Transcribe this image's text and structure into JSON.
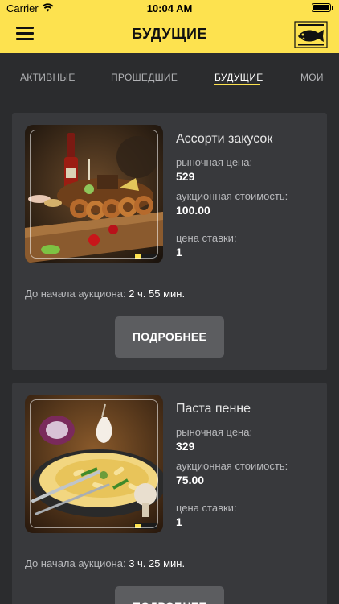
{
  "status_bar": {
    "carrier": "Carrier",
    "time": "10:04 AM"
  },
  "header": {
    "title": "БУДУЩИЕ",
    "accent_color": "#fde24f"
  },
  "tabs": [
    {
      "label": "АКТИВНЫЕ",
      "active": false
    },
    {
      "label": "ПРОШЕДШИЕ",
      "active": false
    },
    {
      "label": "БУДУЩИЕ",
      "active": true
    },
    {
      "label": "МОИ",
      "active": false
    }
  ],
  "labels": {
    "market_price": "рыночная цена:",
    "auction_cost": "аукционная стоимость:",
    "bid_price": "цена ставки:",
    "countdown_prefix": "До начала аукциона: ",
    "details_button": "ПОДРОБНЕЕ"
  },
  "lots": [
    {
      "title": "Ассорти закусок",
      "market_price": "529",
      "auction_cost": "100.00",
      "bid_price": "1",
      "countdown": "2 ч. 55 мин.",
      "image": "appetizer-platter-photo"
    },
    {
      "title": "Паста пенне",
      "market_price": "329",
      "auction_cost": "75.00",
      "bid_price": "1",
      "countdown": "3 ч. 25 мин.",
      "image": "penne-pasta-photo"
    }
  ]
}
